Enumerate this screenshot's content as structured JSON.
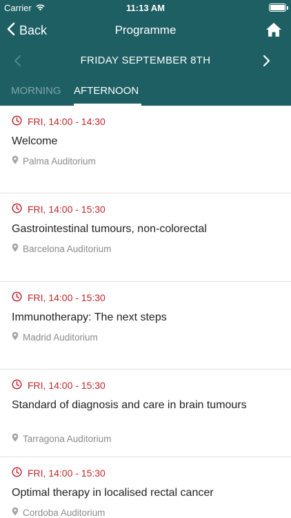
{
  "status": {
    "carrier": "Carrier",
    "time": "11:13 AM"
  },
  "nav": {
    "back_label": "Back",
    "title": "Programme"
  },
  "day": {
    "title": "FRIDAY SEPTEMBER 8TH"
  },
  "tabs": [
    {
      "label": "MORNING",
      "selected": false
    },
    {
      "label": "AFTERNOON",
      "selected": true
    }
  ],
  "sessions": [
    {
      "time": "FRI, 14:00 - 14:30",
      "title": "Welcome",
      "location": "Palma Auditorium"
    },
    {
      "time": "FRI, 14:00 - 15:30",
      "title": "Gastrointestinal tumours, non-colorectal",
      "location": "Barcelona Auditorium"
    },
    {
      "time": "FRI, 14:00 - 15:30",
      "title": "Immunotherapy: The next steps",
      "location": "Madrid Auditorium"
    },
    {
      "time": "FRI, 14:00 - 15:30",
      "title": "Standard of diagnosis and care in brain tumours",
      "location": "Tarragona Auditorium"
    },
    {
      "time": "FRI, 14:00 - 15:30",
      "title": "Optimal therapy in localised rectal cancer",
      "location": "Cordoba Auditorium"
    }
  ],
  "colors": {
    "header": "#1d5f63",
    "time_accent": "#c0262d",
    "location_gray": "#8a8a8a"
  },
  "icons": [
    "wifi-icon",
    "battery-icon",
    "chevron-left-icon",
    "home-icon",
    "clock-icon",
    "location-pin-icon",
    "chevron-right-icon"
  ]
}
